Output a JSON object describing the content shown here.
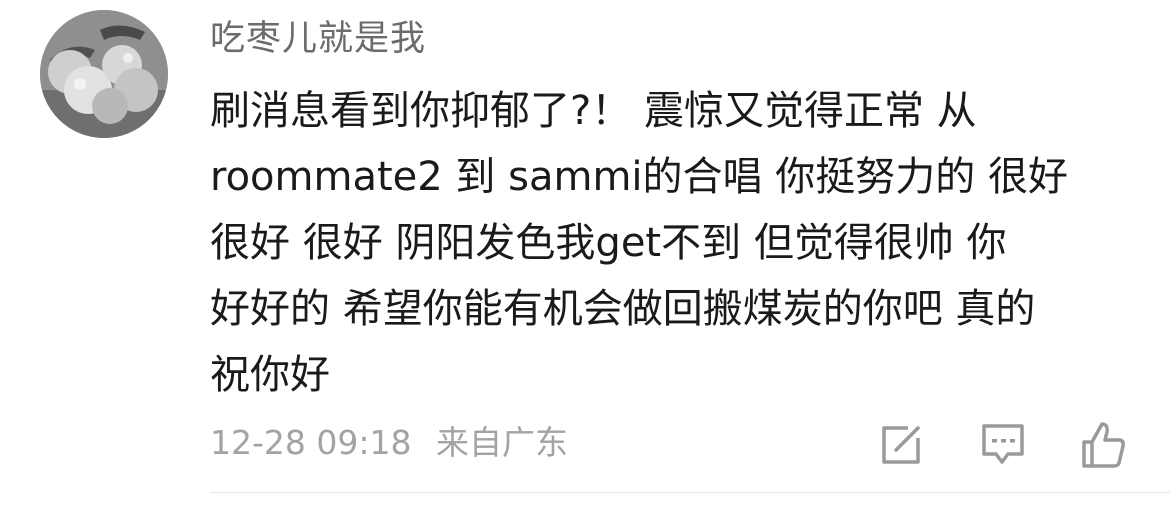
{
  "comment": {
    "username": "吃枣儿就是我",
    "body_lines": [
      "刷消息看到你抑郁了?！ 震惊又觉得正常 从",
      "roommate2 到 sammi的合唱 你挺努力的 很好",
      "很好 很好 阴阳发色我get不到 但觉得很帅 你",
      "好好的 希望你能有机会做回搬煤炭的你吧 真的",
      "祝你好"
    ],
    "timestamp": "12-28 09:18",
    "location": "来自广东",
    "actions": {
      "share_icon": "edit-share-icon",
      "reply_icon": "comment-bubble-icon",
      "like_icon": "thumbs-up-icon"
    },
    "colors": {
      "username": "#6b6b6b",
      "body_text": "#1a1a1a",
      "meta_text": "#a3a3a3",
      "icon": "#9a9a9a"
    }
  }
}
